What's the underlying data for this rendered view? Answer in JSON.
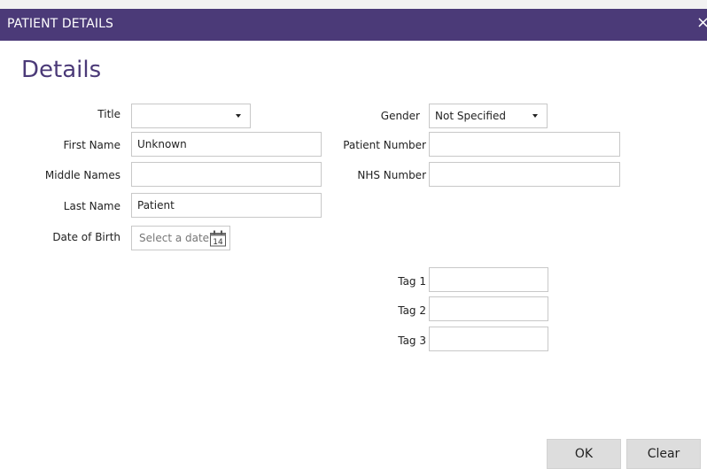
{
  "window": {
    "title": "PATIENT DETAILS",
    "close_glyph": "×"
  },
  "section_heading": "Details",
  "form": {
    "title": {
      "label": "Title",
      "value": ""
    },
    "first_name": {
      "label": "First Name",
      "value": "Unknown"
    },
    "middle_names": {
      "label": "Middle Names",
      "value": ""
    },
    "last_name": {
      "label": "Last Name",
      "value": "Patient"
    },
    "date_of_birth": {
      "label": "Date of Birth",
      "placeholder": "Select a date",
      "calendar_day": "14"
    },
    "gender": {
      "label": "Gender",
      "value": "Not Specified"
    },
    "patient_number": {
      "label": "Patient Number",
      "value": ""
    },
    "nhs_number": {
      "label": "NHS Number",
      "value": ""
    },
    "tag1": {
      "label": "Tag 1",
      "value": ""
    },
    "tag2": {
      "label": "Tag 2",
      "value": ""
    },
    "tag3": {
      "label": "Tag 3",
      "value": ""
    }
  },
  "buttons": {
    "ok": "OK",
    "clear": "Clear"
  },
  "colors": {
    "titlebar": "#4b3a78",
    "heading": "#4b3a78",
    "button_bg": "#dddddd"
  },
  "icons": {
    "close": "close-icon",
    "calendar": "calendar-icon",
    "dropdown": "chevron-down-icon"
  }
}
